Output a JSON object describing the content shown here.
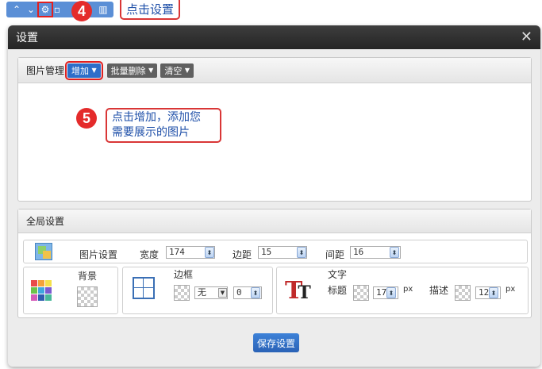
{
  "annotations": {
    "step4_number": "4",
    "step4_text": "点击设置",
    "step5_number": "5",
    "step5_text_line1": "点击增加，添加您",
    "step5_text_line2": "需要展示的图片"
  },
  "dialog": {
    "title": "设置",
    "close_icon": "close-icon"
  },
  "image_manager": {
    "title": "图片管理",
    "add_button": "增加",
    "batch_delete_button": "批量删除",
    "clear_button": "清空"
  },
  "global_settings": {
    "title": "全局设置",
    "image_settings_label": "图片设置",
    "width_label": "宽度",
    "width_value": "174",
    "padding_label": "边距",
    "padding_value": "15",
    "spacing_label": "间距",
    "spacing_value": "16",
    "background_label": "背景",
    "border_label": "边框",
    "border_style_value": "无",
    "border_width_value": "0",
    "text_label": "文字",
    "heading_label": "标题",
    "heading_size_value": "17",
    "heading_unit": "px",
    "desc_label": "描述",
    "desc_size_value": "12",
    "desc_unit": "px"
  },
  "save_button": "保存设置"
}
